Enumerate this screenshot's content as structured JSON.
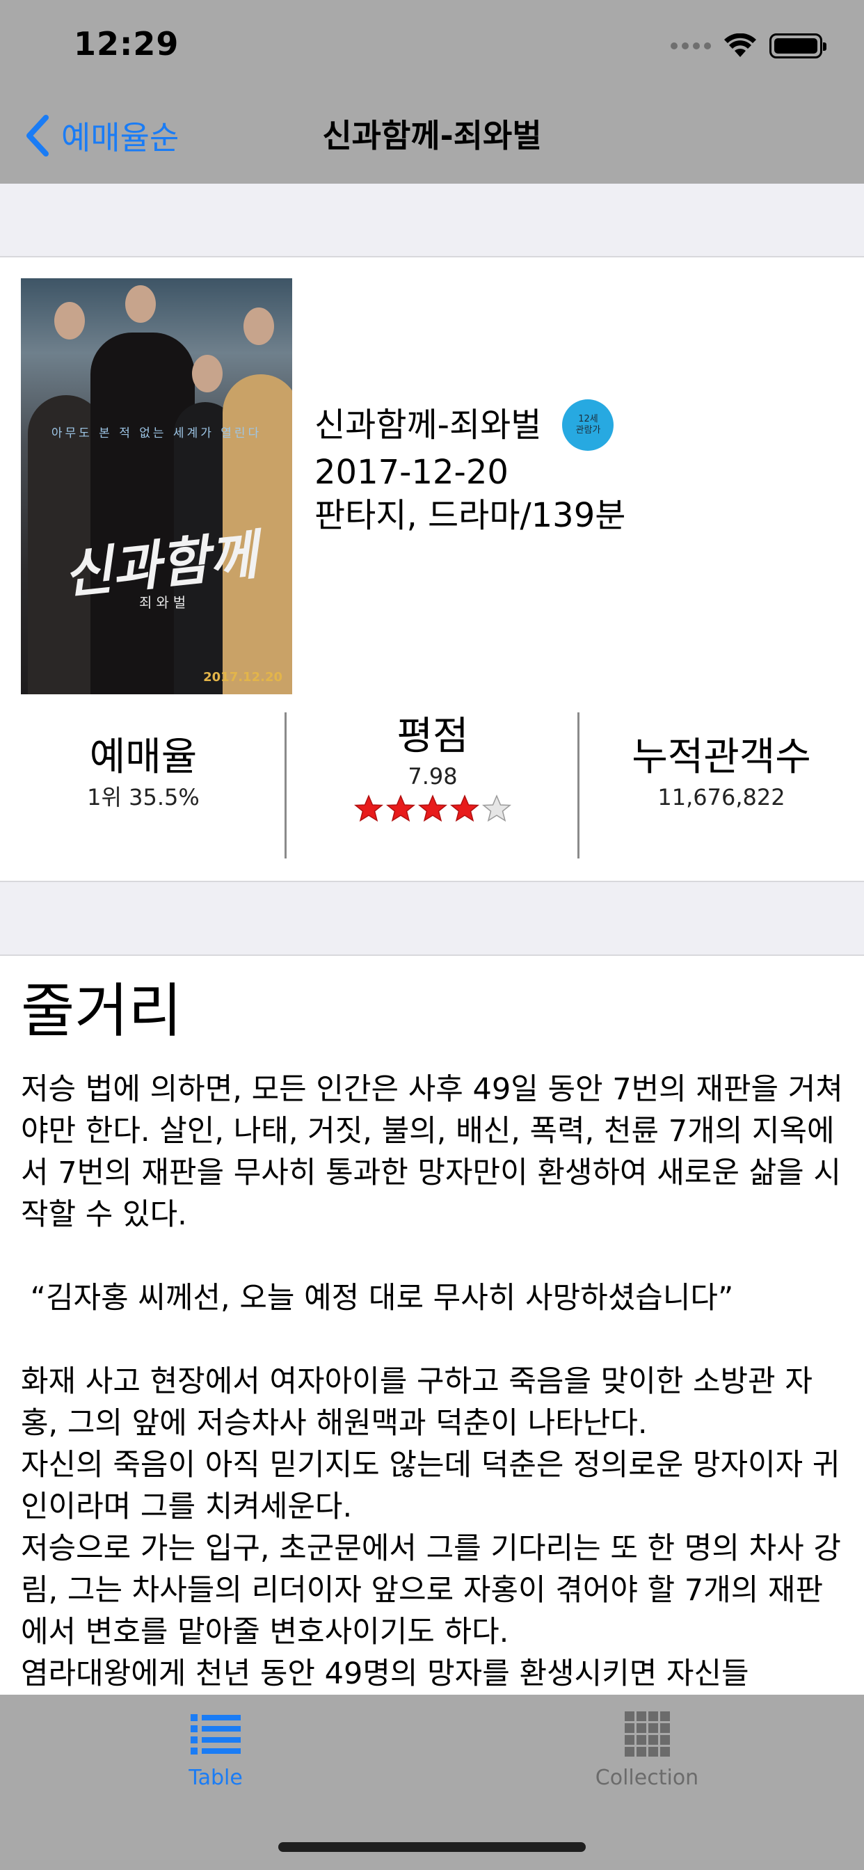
{
  "status_bar": {
    "time": "12:29"
  },
  "nav": {
    "back_label": "예매율순",
    "title": "신과함께-죄와벌"
  },
  "movie": {
    "poster_tagline": "아무도 본 적 없는 세계가 열린다",
    "poster_title": "신과함께",
    "poster_subtitle": "죄와벌",
    "poster_date": "2017.12.20",
    "title": "신과함께-죄와벌",
    "grade_line1": "12세",
    "grade_line2": "관람가",
    "grade_color": "#27a9e1",
    "release_date": "2017-12-20",
    "genre_duration": "판타지, 드라마/139분"
  },
  "stats": {
    "reservation_label": "예매율",
    "reservation_value": "1위 35.5%",
    "rating_label": "평점",
    "rating_value": "7.98",
    "rating_stars": 4,
    "rating_star_max": 5,
    "audience_label": "누적관객수",
    "audience_value": "11,676,822"
  },
  "synopsis": {
    "heading": "줄거리",
    "paragraphs": [
      "저승 법에 의하면, 모든 인간은 사후 49일 동안 7번의 재판을 거쳐야만 한다. 살인, 나태, 거짓, 불의, 배신, 폭력, 천륜 7개의 지옥에서 7번의 재판을 무사히 통과한 망자만이 환생하여 새로운 삶을 시작할 수 있다.",
      " “김자홍 씨께선, 오늘 예정 대로 무사히 사망하셨습니다”",
      "화재 사고 현장에서 여자아이를 구하고 죽음을 맞이한 소방관 자홍, 그의 앞에 저승차사 해원맥과 덕춘이 나타난다.\n자신의 죽음이 아직 믿기지도 않는데 덕춘은 정의로운 망자이자 귀인이라며 그를 치켜세운다.\n저승으로 가는 입구, 초군문에서 그를 기다리는 또 한 명의 차사 강림, 그는 차사들의 리더이자 앞으로 자홍이 겪어야 할 7개의 재판에서 변호를 맡아줄 변호사이기도 하다.\n염라대왕에게 천년 동안 49명의 망자를 환생시키면 자신들"
    ]
  },
  "tabbar": {
    "tab1_label": "Table",
    "tab2_label": "Collection",
    "active_color": "#1a7cf5",
    "inactive_color": "#6b6b6b"
  }
}
